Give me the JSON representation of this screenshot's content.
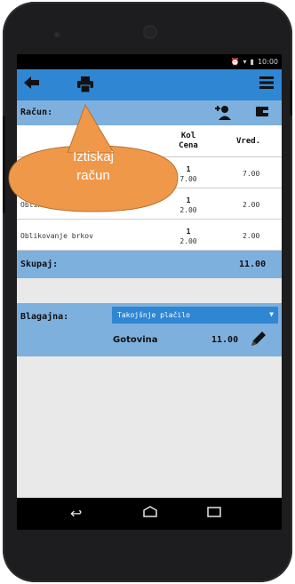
{
  "statusbar": {
    "time": "10:00",
    "icons": [
      "alarm-icon",
      "wifi-icon",
      "battery-icon"
    ]
  },
  "toolbar": {
    "left_icons": [
      "back-arrow-icon",
      "print-icon"
    ],
    "right_icon": "menu-icon"
  },
  "header": {
    "label": "Račun:",
    "icons": [
      "add-person-icon",
      "wallet-icon"
    ]
  },
  "columns": {
    "qty": "Kol",
    "price": "Cena",
    "value": "Vred."
  },
  "items": [
    {
      "name": "Oblikovanje brade",
      "qty": "1",
      "price": "2.00",
      "value": "2.00"
    },
    {
      "name": "Oblikovanje brkov",
      "qty": "1",
      "price": "2.00",
      "value": "2.00"
    }
  ],
  "hidden_item": {
    "qty": "1",
    "price": "7.00",
    "value": "7.00"
  },
  "total": {
    "label": "Skupaj:",
    "value": "11.00"
  },
  "cash_register": {
    "label": "Blagajna:",
    "select_value": "Takojšnje plačilo",
    "method": "Gotovina",
    "amount": "11.00"
  },
  "callout": {
    "line1": "Iztiskaj",
    "line2": "račun"
  },
  "colors": {
    "toolbar": "#2f86d3",
    "row_band": "#7eb0de",
    "callout": "#f0984a"
  }
}
